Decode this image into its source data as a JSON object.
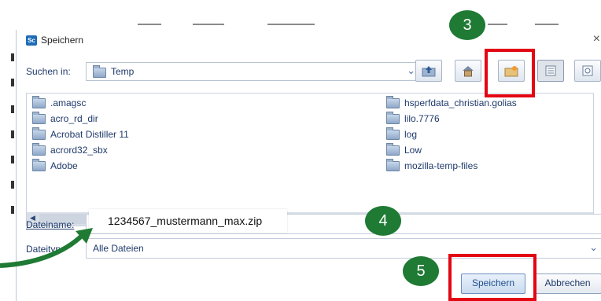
{
  "dialog": {
    "title": "Speichern",
    "app_icon_text": "Sc",
    "close_glyph": "×"
  },
  "lookin": {
    "label": "Suchen in:",
    "value": "Temp"
  },
  "toolbar": {
    "icons": [
      "up-folder-icon",
      "home-icon",
      "new-folder-icon",
      "list-view-icon",
      "details-view-icon"
    ]
  },
  "files": {
    "left": [
      ".amagsc",
      "acro_rd_dir",
      "Acrobat Distiller 11",
      "acrord32_sbx",
      "Adobe"
    ],
    "right": [
      "hsperfdata_christian.golias",
      "lilo.7776",
      "log",
      "Low",
      "mozilla-temp-files"
    ]
  },
  "filename": {
    "label": "Dateiname:",
    "value": "1234567_mustermann_max.zip"
  },
  "filetype": {
    "label": "Dateityp:",
    "value": "Alle Dateien"
  },
  "buttons": {
    "save": "Speichern",
    "cancel": "Abbrechen"
  },
  "annotations": {
    "step3": "3",
    "step4": "4",
    "step5": "5",
    "color_green": "#1f7a34",
    "color_red": "#e30613"
  }
}
